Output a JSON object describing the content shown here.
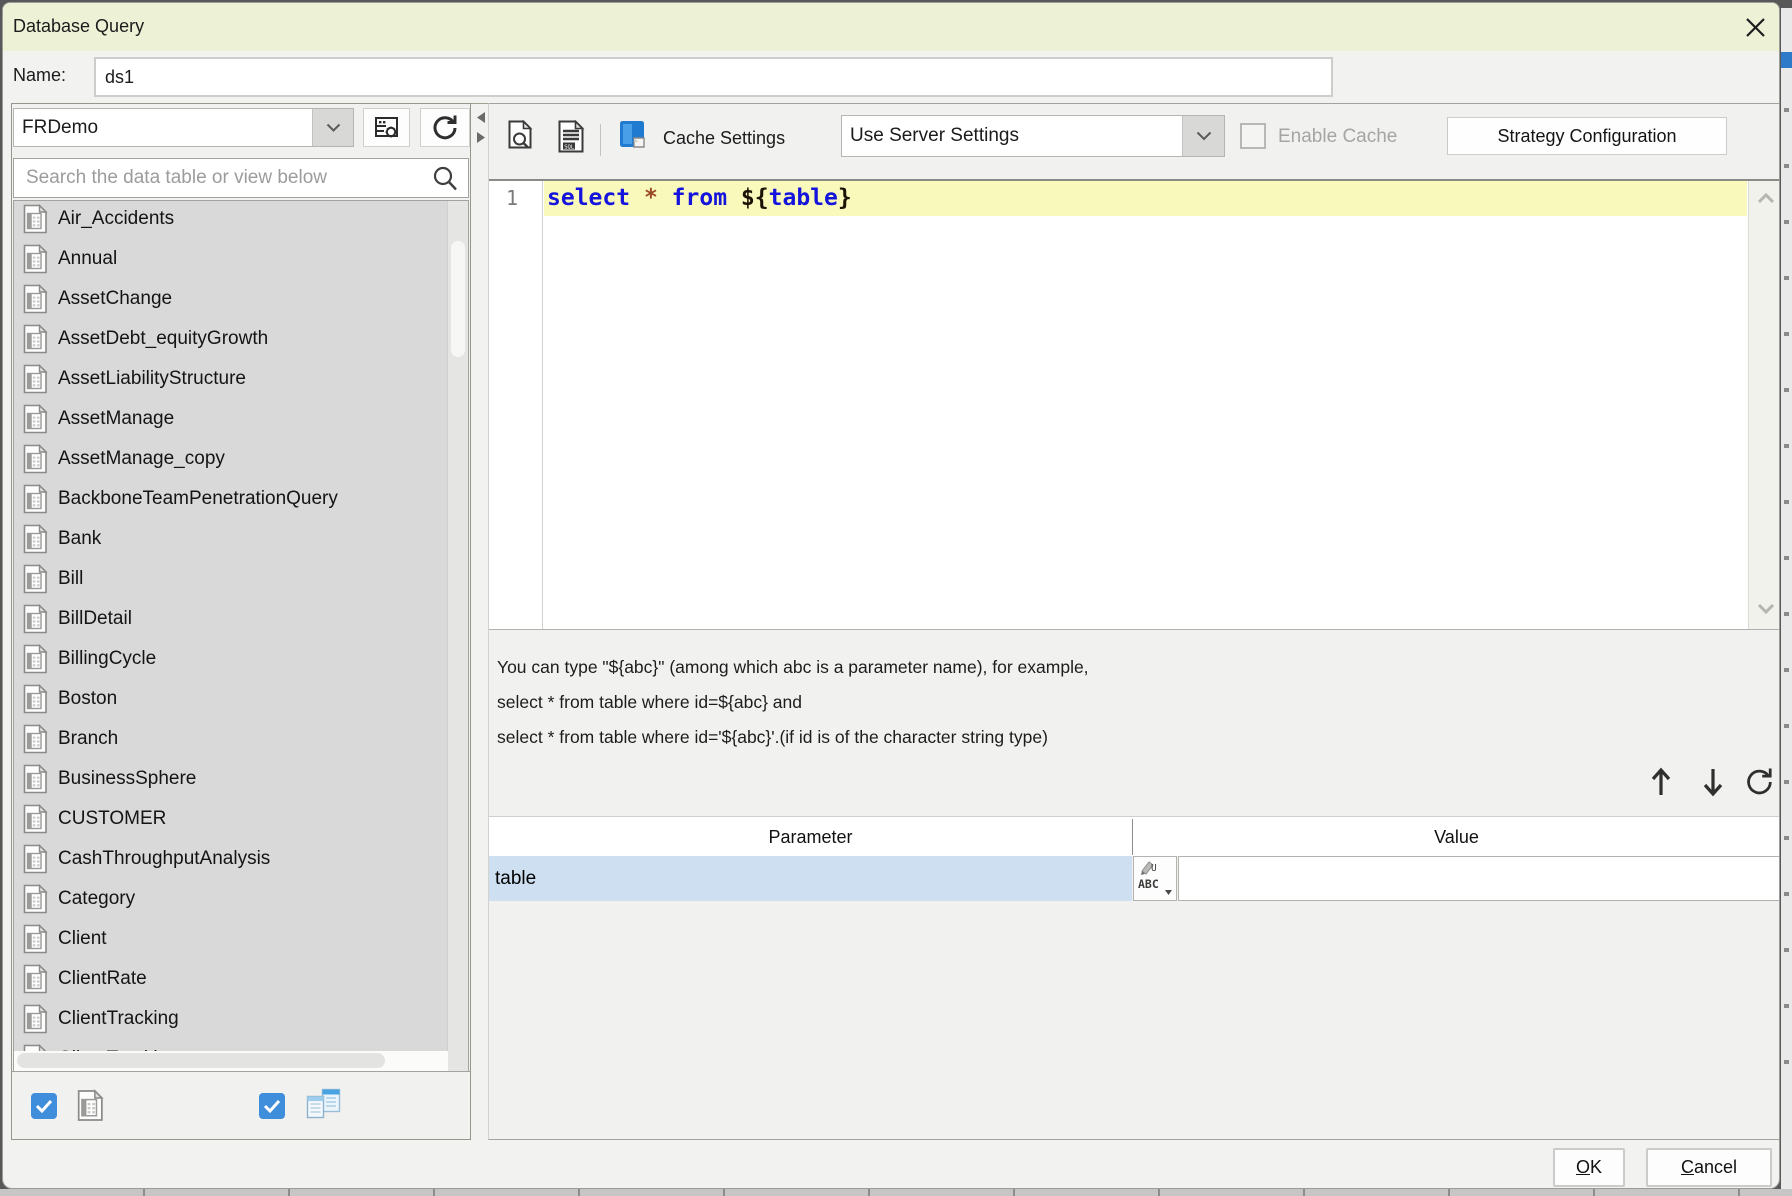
{
  "window": {
    "title": "Database Query"
  },
  "name_row": {
    "label": "Name:",
    "value": "ds1"
  },
  "connection": {
    "selected": "FRDemo"
  },
  "search": {
    "placeholder": "Search the data table or view below"
  },
  "tables": [
    "Air_Accidents",
    "Annual",
    "AssetChange",
    "AssetDebt_equityGrowth",
    "AssetLiabilityStructure",
    "AssetManage",
    "AssetManage_copy",
    "BackboneTeamPenetrationQuery",
    "Bank",
    "Bill",
    "BillDetail",
    "BillingCycle",
    "Boston",
    "Branch",
    "BusinessSphere",
    "CUSTOMER",
    "CashThroughputAnalysis",
    "Category",
    "Client",
    "ClientRate",
    "ClientTracking"
  ],
  "tables_partial": "ClientTracking",
  "toolbar": {
    "cache_settings_label": "Cache Settings",
    "cache_mode": "Use Server Settings",
    "enable_cache_label": "Enable Cache",
    "strategy_button": "Strategy Configuration"
  },
  "editor": {
    "line_number": "1",
    "tokens": [
      {
        "t": "select",
        "c": "kw"
      },
      {
        "t": " ",
        "c": "pl"
      },
      {
        "t": "*",
        "c": "op"
      },
      {
        "t": " ",
        "c": "pl"
      },
      {
        "t": "from",
        "c": "kw"
      },
      {
        "t": " ",
        "c": "pl"
      },
      {
        "t": "${",
        "c": "br"
      },
      {
        "t": "table",
        "c": "kw"
      },
      {
        "t": "}",
        "c": "br"
      }
    ]
  },
  "help": {
    "lines": [
      "You can type \"${abc}\" (among which abc is a parameter name), for example,",
      "select * from table where id=${abc} and",
      "select * from table where id='${abc}'.(if id is of the character string type)"
    ]
  },
  "params": {
    "columns": [
      "Parameter",
      "Value"
    ],
    "rows": [
      {
        "name": "table",
        "value": "",
        "type_icon": "ABC"
      }
    ]
  },
  "footer": {
    "ok": "OK",
    "cancel": "Cancel"
  },
  "colors": {
    "titlebar": "#edf2d6",
    "dialog_bg": "#f2f2f1",
    "list_bg": "#d9d9d9",
    "active_line": "#f9f9bb",
    "keyword": "#1414dc",
    "operator": "#9a4a28",
    "param_row": "#cddff0",
    "checkbox_blue": "#3f8edc"
  },
  "icons": {
    "close": "close-icon",
    "combo_chevron": "chevron-down-icon",
    "connection_config": "connection-config-icon",
    "refresh": "refresh-icon",
    "search": "search-icon",
    "table": "data-table-icon",
    "preview": "sql-preview-icon",
    "sql_export": "sql-export-icon",
    "paste": "paste-sql-icon",
    "move_up": "arrow-up-icon",
    "move_down": "arrow-down-icon",
    "string_type": "string-type-icon",
    "collapse_left": "collapse-left-icon",
    "collapse_right": "collapse-right-icon",
    "view": "data-view-icon",
    "check": "check-icon"
  }
}
